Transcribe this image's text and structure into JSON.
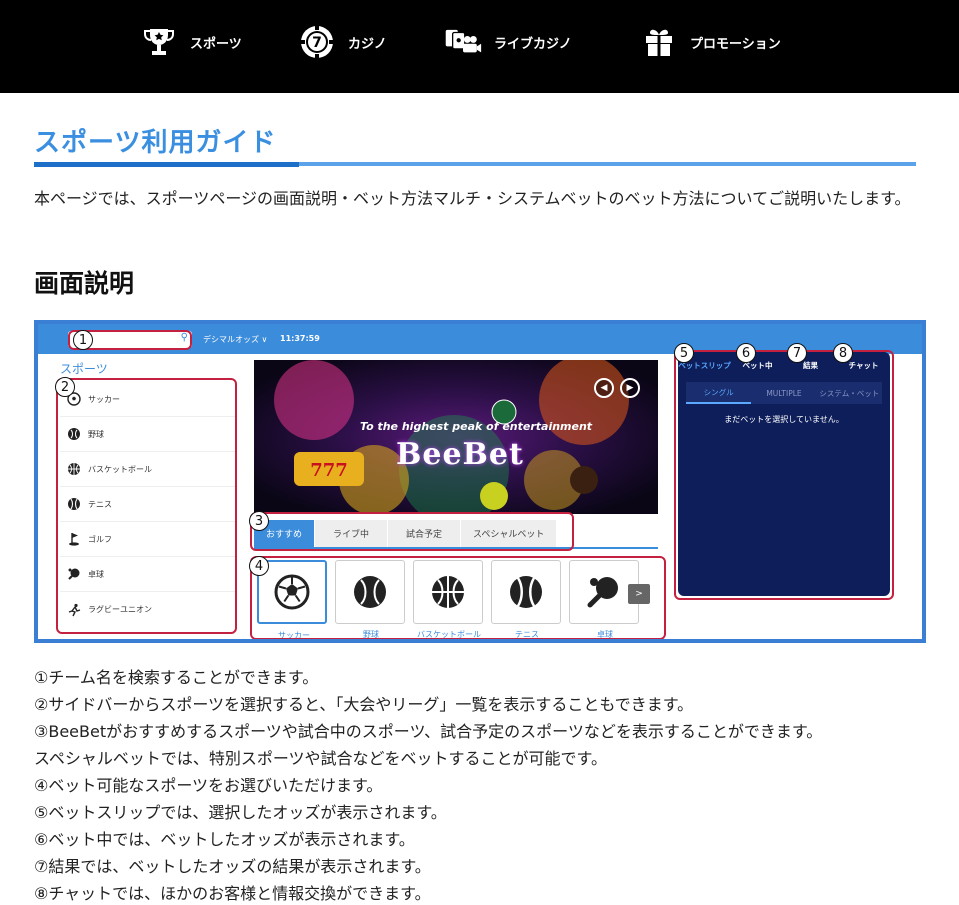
{
  "nav": {
    "items": [
      {
        "label": "スポーツ",
        "icon": "trophy-icon"
      },
      {
        "label": "カジノ",
        "icon": "casino-chip-icon"
      },
      {
        "label": "ライブカジノ",
        "icon": "live-casino-icon"
      },
      {
        "label": "プロモーション",
        "icon": "gift-icon"
      }
    ]
  },
  "page": {
    "title": "スポーツ利用ガイド",
    "intro": "本ページでは、スポーツページの画面説明・ベット方法マルチ・システムベットのベット方法についてご説明いたします。",
    "section_heading": "画面説明"
  },
  "screenshot": {
    "odds_format": "デシマルオッズ ∨",
    "time": "11:37:59",
    "sports_label": "スポーツ",
    "sidebar": [
      "サッカー",
      "野球",
      "バスケットボール",
      "テニス",
      "ゴルフ",
      "卓球",
      "ラグビーユニオン"
    ],
    "banner_tagline": "To the highest peak of entertainment",
    "banner_brand": "BeeBet",
    "tabs": [
      "おすすめ",
      "ライブ中",
      "試合予定",
      "スペシャルベット"
    ],
    "cards": [
      "サッカー",
      "野球",
      "バスケットボール",
      "テニス",
      "卓球"
    ],
    "next_label": ">",
    "betslip_tabs": [
      "ベットスリップ",
      "ベット中",
      "結果",
      "チャット"
    ],
    "betslip_subtabs": [
      "シングル",
      "MULTIPLE",
      "システム・ベット"
    ],
    "betslip_empty": "まだベットを選択していません。",
    "annotations": [
      "1",
      "2",
      "3",
      "4",
      "5",
      "6",
      "7",
      "8"
    ],
    "accent_color": "#3c8cdc",
    "annotation_color": "#c3213f"
  },
  "descriptions": [
    "①チーム名を検索することができます。",
    "②サイドバーからスポーツを選択すると、「大会やリーグ」一覧を表示することもできます。",
    "③BeeBetがおすすめするスポーツや試合中のスポーツ、試合予定のスポーツなどを表示することができます。",
    "スペシャルベットでは、特別スポーツや試合などをベットすることが可能です。",
    "④ベット可能なスポーツをお選びいただけます。",
    "⑤ベットスリップでは、選択したオッズが表示されます。",
    "⑥ベット中では、ベットしたオッズが表示されます。",
    "⑦結果では、ベットしたオッズの結果が表示されます。",
    "⑧チャットでは、ほかのお客様と情報交換ができます。"
  ]
}
